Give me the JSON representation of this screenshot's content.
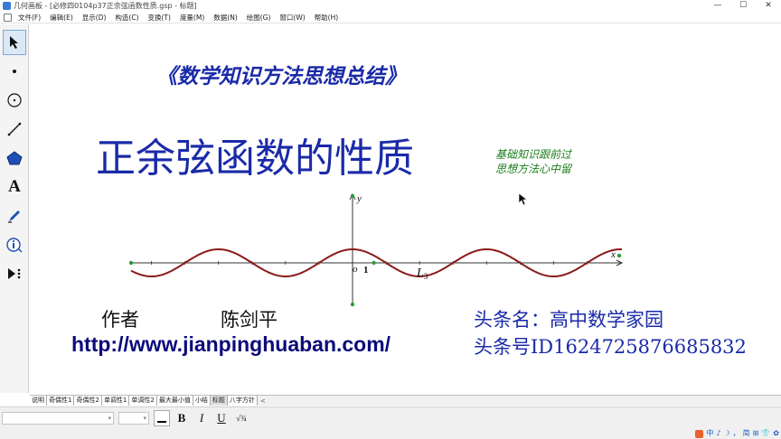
{
  "window": {
    "app_name": "几何画板",
    "title": "几何画板 - [必修四0104p37正余弦函数性质.gsp - 标题]",
    "minimize": "—",
    "maximize": "☐",
    "close": "✕"
  },
  "menu": {
    "items": [
      "文件(F)",
      "编辑(E)",
      "显示(D)",
      "构造(C)",
      "变换(T)",
      "度量(M)",
      "数据(N)",
      "绘图(G)",
      "窗口(W)",
      "帮助(H)"
    ]
  },
  "toolbar": {
    "tools": [
      {
        "name": "arrow-select-tool-icon",
        "selected": true
      },
      {
        "name": "point-tool-icon",
        "selected": false
      },
      {
        "name": "compass-tool-icon",
        "selected": false
      },
      {
        "name": "straightedge-tool-icon",
        "selected": false
      },
      {
        "name": "polygon-tool-icon",
        "selected": false
      },
      {
        "name": "text-tool-icon",
        "selected": false
      },
      {
        "name": "marker-tool-icon",
        "selected": false
      },
      {
        "name": "information-tool-icon",
        "selected": false
      },
      {
        "name": "custom-tool-icon",
        "selected": false
      }
    ],
    "text_tool_glyph": "A"
  },
  "slide": {
    "header": "《数学知识方法思想总结》",
    "title": "正余弦函数的性质",
    "note_line1": "基础知识跟前过",
    "note_line2": "思想方法心中留",
    "author_label": "作者",
    "author_name": "陈剑平",
    "url": "http://www.jianpinghuaban.com/",
    "toutiao_name": "头条名：高中数学家园",
    "toutiao_id": "头条号ID1624725876685832"
  },
  "graph": {
    "y_label": "y",
    "x_label": "x",
    "origin_label": "o",
    "tick_label": "1",
    "curve_label_main": "L",
    "curve_label_sub": "3",
    "curve_color": "#8b1a1a",
    "axis_color": "#333333",
    "point_color": "#2a9d3a"
  },
  "tabs": {
    "items": [
      "说明",
      "奇偶性1",
      "奇偶性2",
      "单调性1",
      "单调性2",
      "最大最小值",
      "小结",
      "标题",
      "八字方针"
    ],
    "active_index": 7,
    "prev": "<"
  },
  "format_bar": {
    "bold": "B",
    "italic": "I",
    "underline": "U",
    "math_symbol": "√¾"
  },
  "ime": {
    "items": [
      "中",
      "♪",
      "☽",
      "，",
      "简",
      "⊞",
      "👕",
      "✿"
    ]
  },
  "colors": {
    "title_blue": "#1a2aa8",
    "note_green": "#1b7d1b",
    "url_navy": "#0a0a7a"
  }
}
